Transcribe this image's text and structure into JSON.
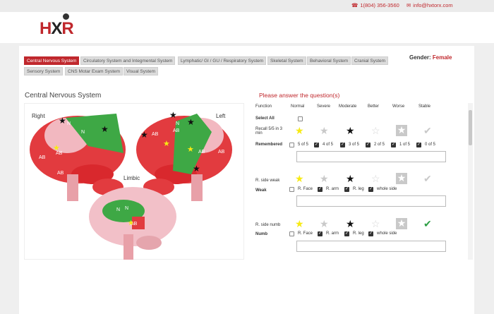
{
  "contact": {
    "phone": "1(804) 356-3560",
    "email": "info@hxtorx.com"
  },
  "logo": {
    "text_a": "H",
    "text_b": "X",
    "text_c": "R"
  },
  "tabs": [
    {
      "label": "Central Nervous System",
      "active": true
    },
    {
      "label": "Circulatory System and Integmental System",
      "active": false
    },
    {
      "label": "Lymphatic/ GI / GU / Respiratory System",
      "active": false
    },
    {
      "label": "Skeletal System",
      "active": false
    },
    {
      "label": "Behavioral System",
      "active": false
    },
    {
      "label": "Cranial System",
      "active": false
    },
    {
      "label": "Sensory System",
      "active": false
    },
    {
      "label": "CNS Motar Exam System",
      "active": false
    },
    {
      "label": "Visual System",
      "active": false
    }
  ],
  "gender": {
    "label": "Gender:",
    "value": "Female"
  },
  "left_panel": {
    "title": "Central Nervous System",
    "right_label": "Right",
    "left_label": "Left",
    "limbic_label": "Limbic",
    "region_labels": [
      "N",
      "N",
      "AB",
      "AB",
      "AB",
      "N",
      "AB",
      "AB",
      "AB",
      "AB",
      "N",
      "N",
      "AB"
    ]
  },
  "questions": {
    "header": "Please answer the question(s)",
    "columns": [
      "Function",
      "Normal",
      "Severe",
      "Moderate",
      "Better",
      "Worse",
      "Stable"
    ],
    "select_all": "Select All",
    "q1": {
      "function": "Recall 5/5 in 3 min",
      "title": "Remembered",
      "options": [
        "5 of 5",
        "4 of 5",
        "3 of 5",
        "2 of 5",
        "1 of 5",
        "0 of 5"
      ]
    },
    "q2": {
      "function": "R. side weak",
      "title": "Weak",
      "options": [
        "R. Face",
        "R. arm",
        "R. leg",
        "whole side"
      ]
    },
    "q3": {
      "function": "R. side numb",
      "title": "Numb",
      "options": [
        "R. Face",
        "R. arm",
        "R. leg",
        "whole side"
      ]
    }
  },
  "colors": {
    "accent": "#c0282d",
    "normal_star": "#f7ea14",
    "severe_star": "#c9c9c9",
    "moderate_star": "#111111",
    "stable_check_on": "#2e9e45"
  }
}
